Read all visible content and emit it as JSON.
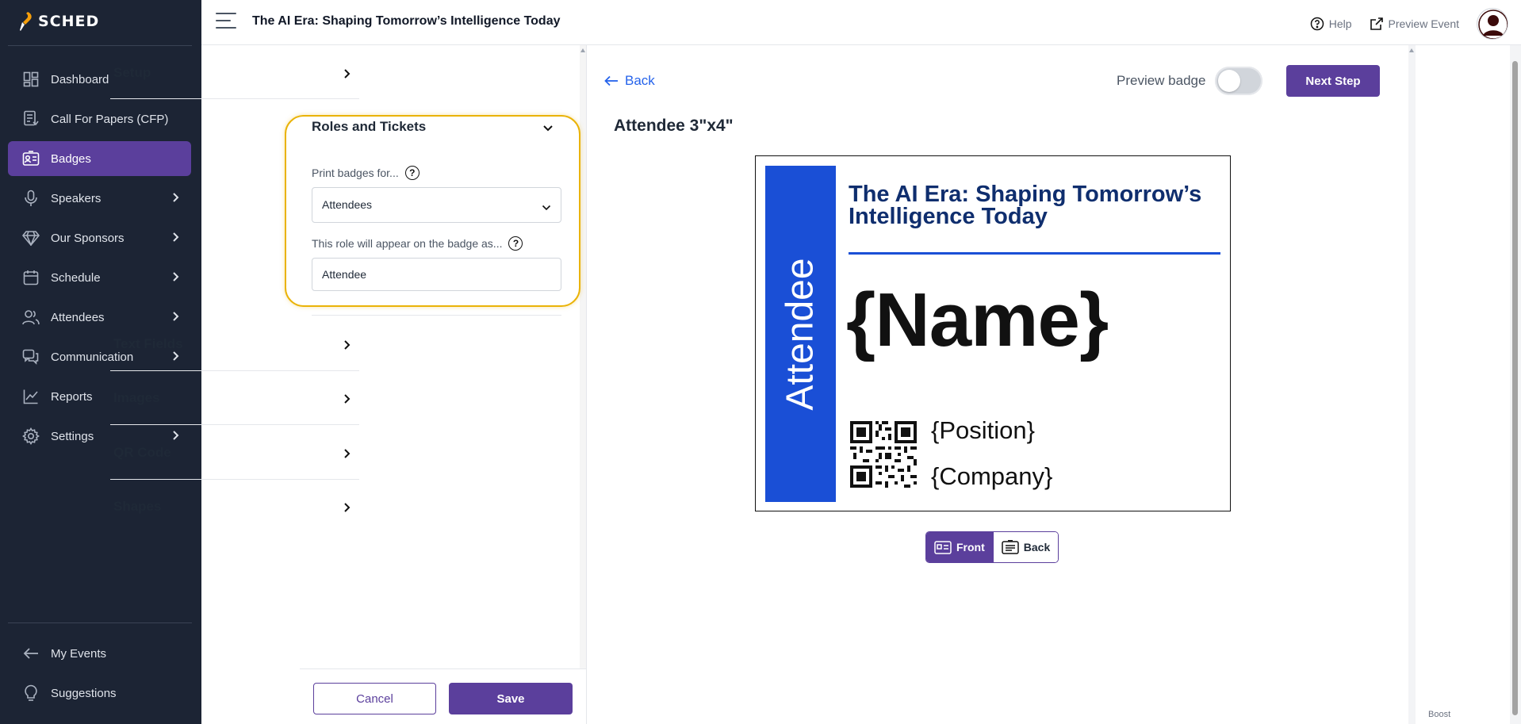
{
  "brand": {
    "name": "SCHED"
  },
  "sidebar": {
    "items": [
      {
        "label": "Dashboard",
        "icon": "dashboard-icon",
        "chevron": false,
        "active": false
      },
      {
        "label": "Call For Papers (CFP)",
        "icon": "document-icon",
        "chevron": false,
        "active": false
      },
      {
        "label": "Badges",
        "icon": "badge-icon",
        "chevron": false,
        "active": true
      },
      {
        "label": "Speakers",
        "icon": "microphone-icon",
        "chevron": true,
        "active": false
      },
      {
        "label": "Our Sponsors",
        "icon": "diamond-icon",
        "chevron": true,
        "active": false
      },
      {
        "label": "Schedule",
        "icon": "calendar-icon",
        "chevron": true,
        "active": false
      },
      {
        "label": "Attendees",
        "icon": "users-icon",
        "chevron": true,
        "active": false
      },
      {
        "label": "Communication",
        "icon": "chat-icon",
        "chevron": true,
        "active": false
      },
      {
        "label": "Reports",
        "icon": "chart-icon",
        "chevron": false,
        "active": false
      },
      {
        "label": "Settings",
        "icon": "gear-icon",
        "chevron": true,
        "active": false
      }
    ],
    "bottom_items": [
      {
        "label": "My Events",
        "icon": "arrow-left-icon"
      },
      {
        "label": "Suggestions",
        "icon": "lightbulb-icon"
      }
    ]
  },
  "topbar": {
    "event_title": "The AI Era: Shaping Tomorrow’s Intelligence Today",
    "help_label": "Help",
    "preview_event_label": "Preview Event"
  },
  "settings": {
    "sections": [
      {
        "title": "Setup"
      },
      {
        "title": "Roles and Tickets"
      },
      {
        "title": "Text Fields"
      },
      {
        "title": "Images"
      },
      {
        "title": "QR Code"
      },
      {
        "title": "Shapes"
      }
    ],
    "print_for_label": "Print badges for...",
    "print_for_value": "Attendees",
    "role_label": "This role will appear on the badge as...",
    "role_value": "Attendee",
    "cancel_label": "Cancel",
    "save_label": "Save"
  },
  "preview": {
    "back_label": "Back",
    "preview_badge_label": "Preview badge",
    "preview_badge_on": false,
    "next_step_label": "Next Step",
    "heading": "Attendee 3\"x4\"",
    "front_label": "Front",
    "back_side_label": "Back",
    "active_side": "Front"
  },
  "badge": {
    "role": "Attendee",
    "event_title": "The AI Era: Shaping Tomorrow’s Intelligence Today",
    "name_placeholder": "{Name}",
    "position_placeholder": "{Position}",
    "company_placeholder": "{Company}"
  },
  "footer": {
    "boost_label": "Boost"
  },
  "colors": {
    "sidebar_bg": "#1c2434",
    "accent_purple": "#5b3f9c",
    "badge_blue": "#1a4fd6",
    "badge_title": "#0f2e6e",
    "highlight": "#eab308",
    "link_blue": "#2563eb"
  }
}
